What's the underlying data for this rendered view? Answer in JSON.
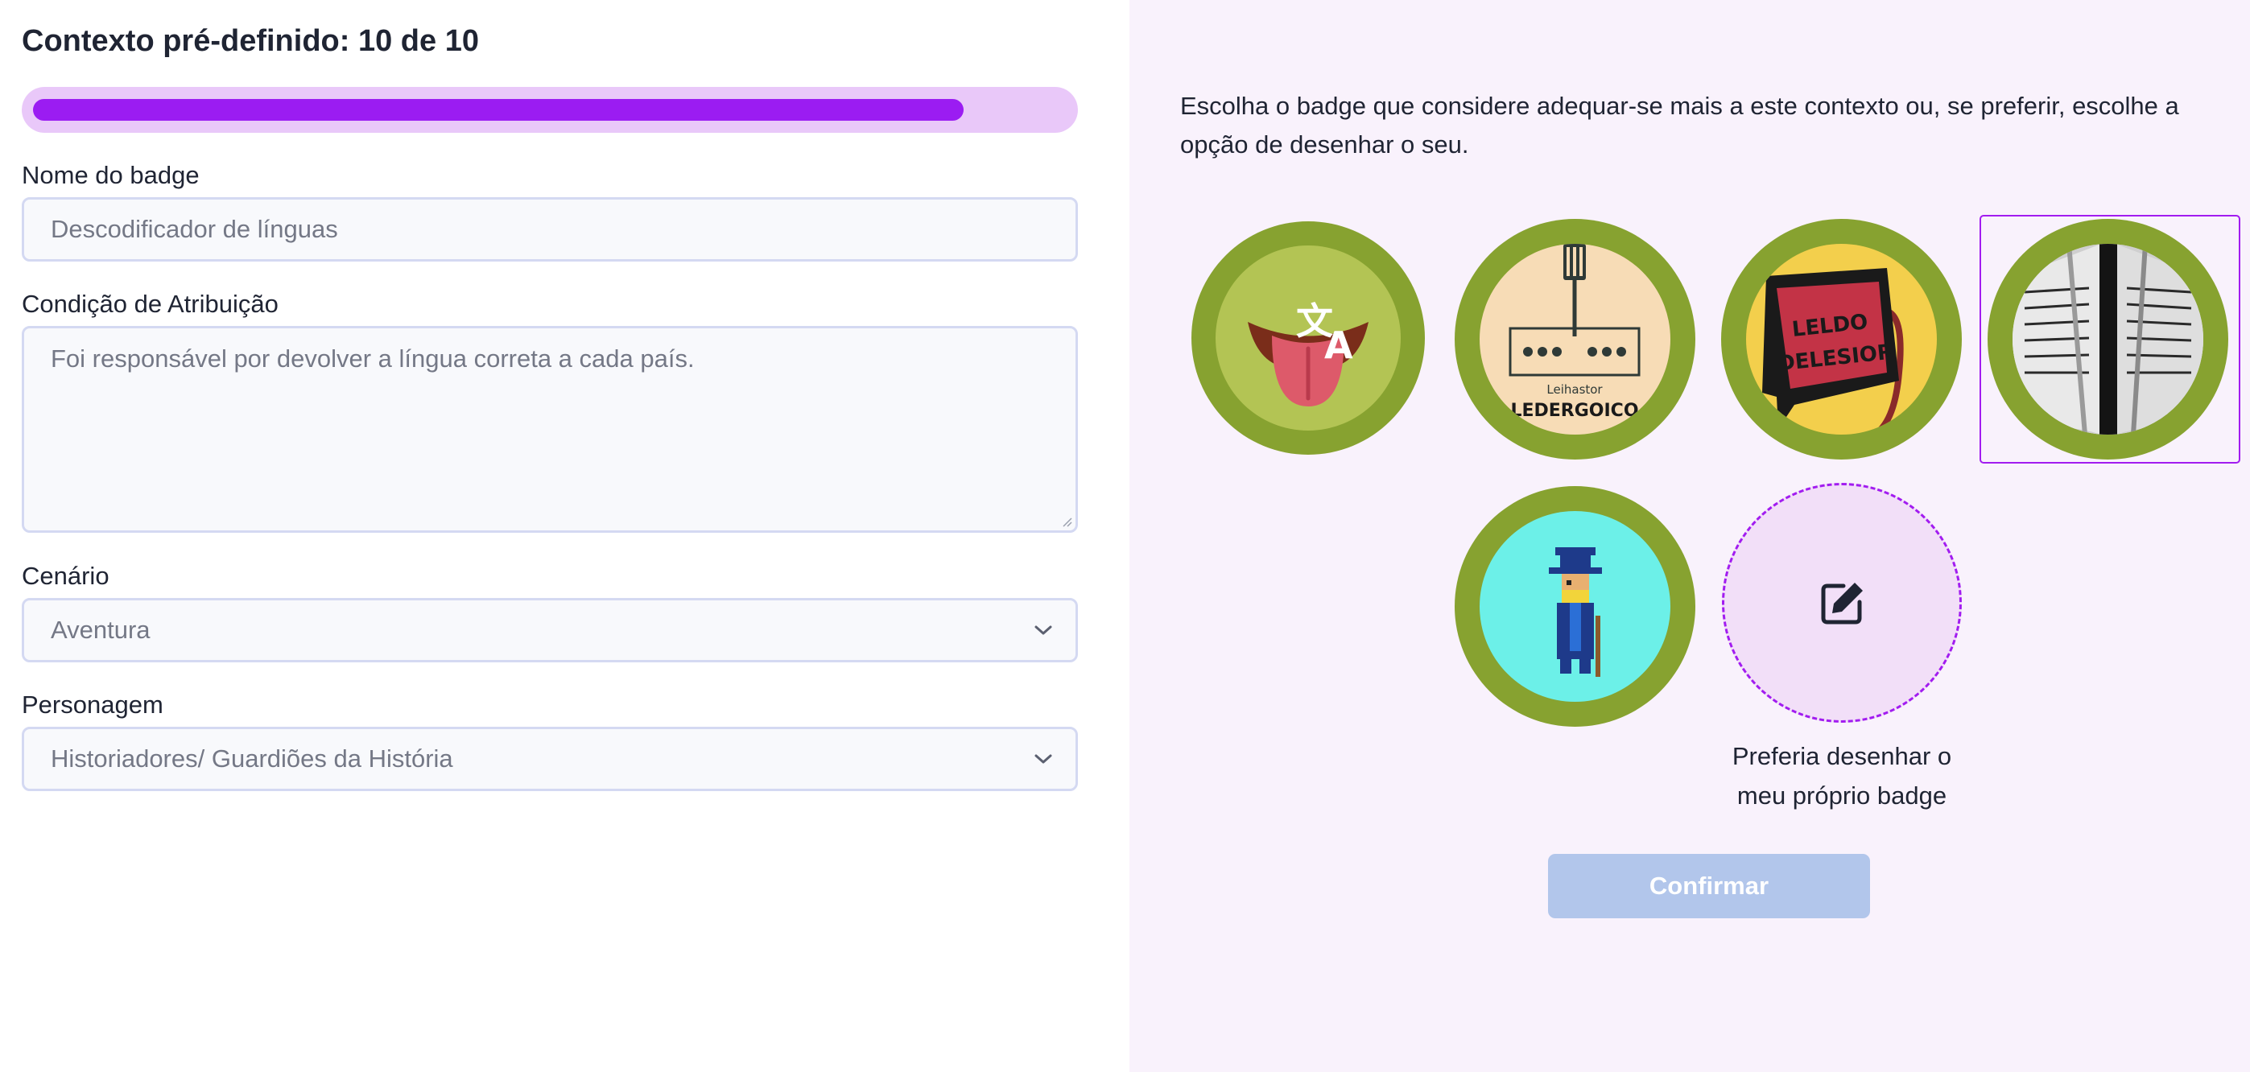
{
  "header": {
    "title": "Contexto pré-definido: 10 de 10"
  },
  "progress": {
    "value": 0.9
  },
  "form": {
    "badge_name": {
      "label": "Nome do badge",
      "placeholder": "Descodificador de línguas"
    },
    "condition": {
      "label": "Condição de Atribuição",
      "placeholder": "Foi responsável por devolver a língua correta a cada país."
    },
    "scenario": {
      "label": "Cenário",
      "value": "Aventura"
    },
    "character": {
      "label": "Personagem",
      "value": "Historiadores/ Guardiões da História"
    }
  },
  "panel": {
    "instructions": "Escolha o badge que considere adequar-se mais a este contexto ou, se preferir, escolhe a opção de desenhar o seu.",
    "badges": [
      {
        "icon": "tongue-translate-icon"
      },
      {
        "icon": "reader-device-icon",
        "text_small": "Leihastor",
        "text_big": "LEDERGOICO"
      },
      {
        "icon": "sign-icon",
        "sign_line1": "LELDO",
        "sign_line2": "DELESIOR"
      },
      {
        "icon": "open-book-icon",
        "selected": true
      },
      {
        "icon": "pixel-historian-icon"
      }
    ],
    "draw_own": {
      "icon": "edit-icon",
      "caption_line1": "Preferia desenhar o",
      "caption_line2": "meu próprio badge"
    },
    "confirm_label": "Confirmar"
  },
  "colors": {
    "accent": "#9b1cf2",
    "badge_ring": "#87a230",
    "confirm_disabled": "#b2c6eb"
  }
}
